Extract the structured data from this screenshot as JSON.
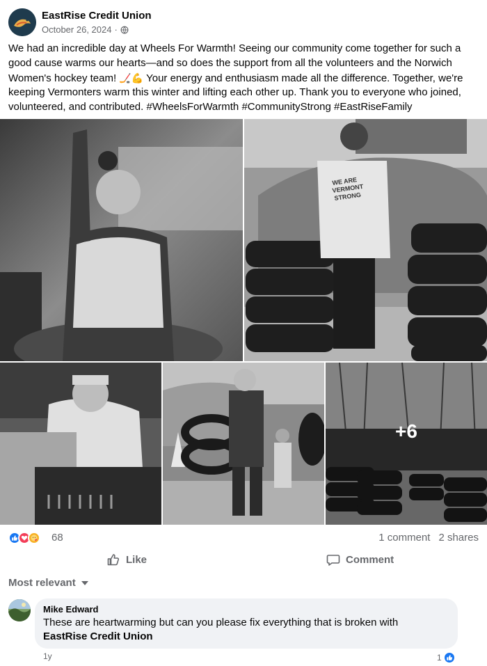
{
  "post": {
    "page_name": "EastRise Credit Union",
    "date": "October 26, 2024",
    "separator": "·",
    "audience_icon": "globe-icon",
    "text_part1": "We had an incredible day at Wheels For Warmth! Seeing our community come together for such a good cause warms our hearts—and so does the support from all the volunteers and the Norwich Women's hockey team! ",
    "text_emojis": "🏒💪",
    "text_part2": " Your energy and enthusiasm made all the difference. Together, we're keeping Vermonters warm this winter and lifting each other up. Thank you to everyone who joined, volunteered, and contributed. #WheelsForWarmth #CommunityStrong #EastRiseFamily"
  },
  "photos": {
    "vest_text_line1": "WE ARE",
    "vest_text_line2": "VERMONT",
    "vest_text_line3": "STRONG",
    "more_count": "+6"
  },
  "stats": {
    "reaction_icons": [
      "like-icon",
      "love-icon",
      "care-icon"
    ],
    "reaction_count": "68",
    "comments": "1 comment",
    "shares": "2 shares"
  },
  "actions": {
    "like_label": "Like",
    "comment_label": "Comment"
  },
  "comments_section": {
    "filter_label": "Most relevant",
    "comment": {
      "author": "Mike Edward",
      "text": "These are heartwarming but can you please fix everything that is broken with",
      "tag": "EastRise Credit Union",
      "time": "1y",
      "like_count": "1"
    }
  },
  "colors": {
    "accent": "#1877f2",
    "text_primary": "#050505",
    "text_secondary": "#65676b",
    "bubble_bg": "#f0f2f5"
  }
}
